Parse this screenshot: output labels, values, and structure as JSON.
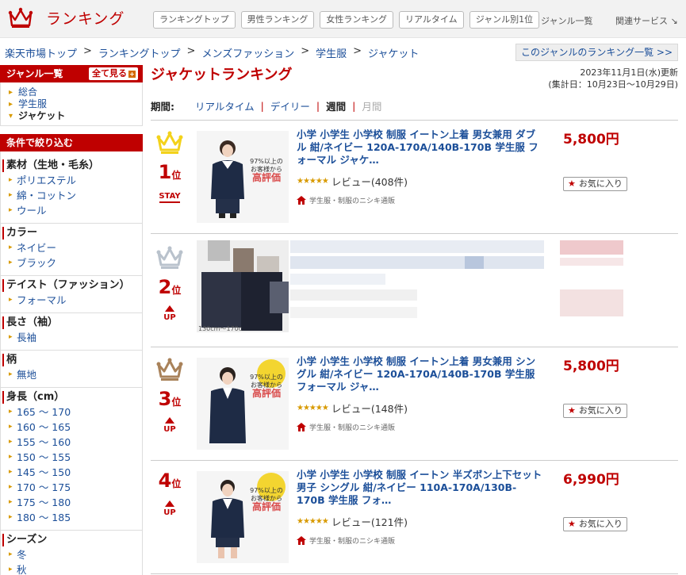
{
  "header": {
    "title": "ランキング",
    "tabs": [
      "ランキングトップ",
      "男性ランキング",
      "女性ランキング",
      "リアルタイム",
      "ジャンル別1位"
    ],
    "genre_list": "ジャンル一覧",
    "related": "関連サービス ↘"
  },
  "breadcrumb": [
    "楽天市場トップ",
    "ランキングトップ",
    "メンズファッション",
    "学生服",
    "ジャケット"
  ],
  "breadcrumb_sep": ">",
  "genre_ranking_link": "このジャンルのランキング一覧 >>",
  "sidebar": {
    "genre_head": "ジャンル一覧",
    "show_all": "全て見る",
    "genres": [
      "総合",
      "学生服",
      "ジャケット"
    ],
    "filter_head": "条件で絞り込む",
    "groups": [
      {
        "title": "素材（生地・毛糸）",
        "options": [
          "ポリエステル",
          "綿・コットン",
          "ウール"
        ]
      },
      {
        "title": "カラー",
        "options": [
          "ネイビー",
          "ブラック"
        ]
      },
      {
        "title": "テイスト（ファッション）",
        "options": [
          "フォーマル"
        ]
      },
      {
        "title": "長さ（袖）",
        "options": [
          "長袖"
        ]
      },
      {
        "title": "柄",
        "options": [
          "無地"
        ]
      },
      {
        "title": "身長（cm）",
        "options": [
          "165 ～ 170",
          "160 ～ 165",
          "155 ～ 160",
          "150 ～ 155",
          "145 ～ 150",
          "170 ～ 175",
          "175 ～ 180",
          "180 ～ 185"
        ]
      },
      {
        "title": "シーズン",
        "options": [
          "冬",
          "秋"
        ]
      }
    ]
  },
  "main": {
    "title": "ジャケットランキング",
    "updated": "2023年11月1日(水)更新",
    "range": "(集計日：10月23日～10月29日)",
    "period_label": "期間:",
    "periods": [
      "リアルタイム",
      "デイリー",
      "週間",
      "月間"
    ],
    "items": [
      {
        "rank": "1",
        "rank_suffix": "位",
        "move": "STAY",
        "name": "小学 小学生 小学校 制服 イートン上着 男女兼用 ダブル 紺/ネイビー 120A-170A/140B-170B 学生服 フォーマル ジャケ…",
        "stars": "★★★★★",
        "review": "レビュー(408件)",
        "shop": "学生服・制服のニシキ通販",
        "price": "5,800円",
        "fav": "お気に入り",
        "badge_lines": [
          "97%以上の",
          "お客様から",
          "高評価"
        ]
      },
      {
        "rank": "2",
        "rank_suffix": "位",
        "move": "UP",
        "thumb_caption": "130cm～170c"
      },
      {
        "rank": "3",
        "rank_suffix": "位",
        "move": "UP",
        "name": "小学 小学生 小学校 制服 イートン上着 男女兼用 シングル 紺/ネイビー 120A-170A/140B-170B 学生服 フォーマル ジャ…",
        "stars": "★★★★★",
        "review": "レビュー(148件)",
        "shop": "学生服・制服のニシキ通販",
        "price": "5,800円",
        "fav": "お気に入り",
        "badge_lines": [
          "97%以上の",
          "お客様から",
          "高評価"
        ]
      },
      {
        "rank": "4",
        "rank_suffix": "位",
        "move": "UP",
        "name": "小学 小学生 小学校 制服 イートン 半ズボン上下セット 男子 シングル 紺/ネイビー 110A-170A/130B-170B 学生服 フォ…",
        "stars": "★★★★★",
        "review": "レビュー(121件)",
        "shop": "学生服・制服のニシキ通販",
        "price": "6,990円",
        "fav": "お気に入り",
        "badge_lines": [
          "97%以上の",
          "お客様から",
          "高評価"
        ]
      }
    ]
  },
  "colors": {
    "brand": "#bf0000",
    "link": "#1c4f99",
    "gold": "#f3d21b",
    "silver": "#b9c2cc",
    "bronze": "#a9825a"
  }
}
